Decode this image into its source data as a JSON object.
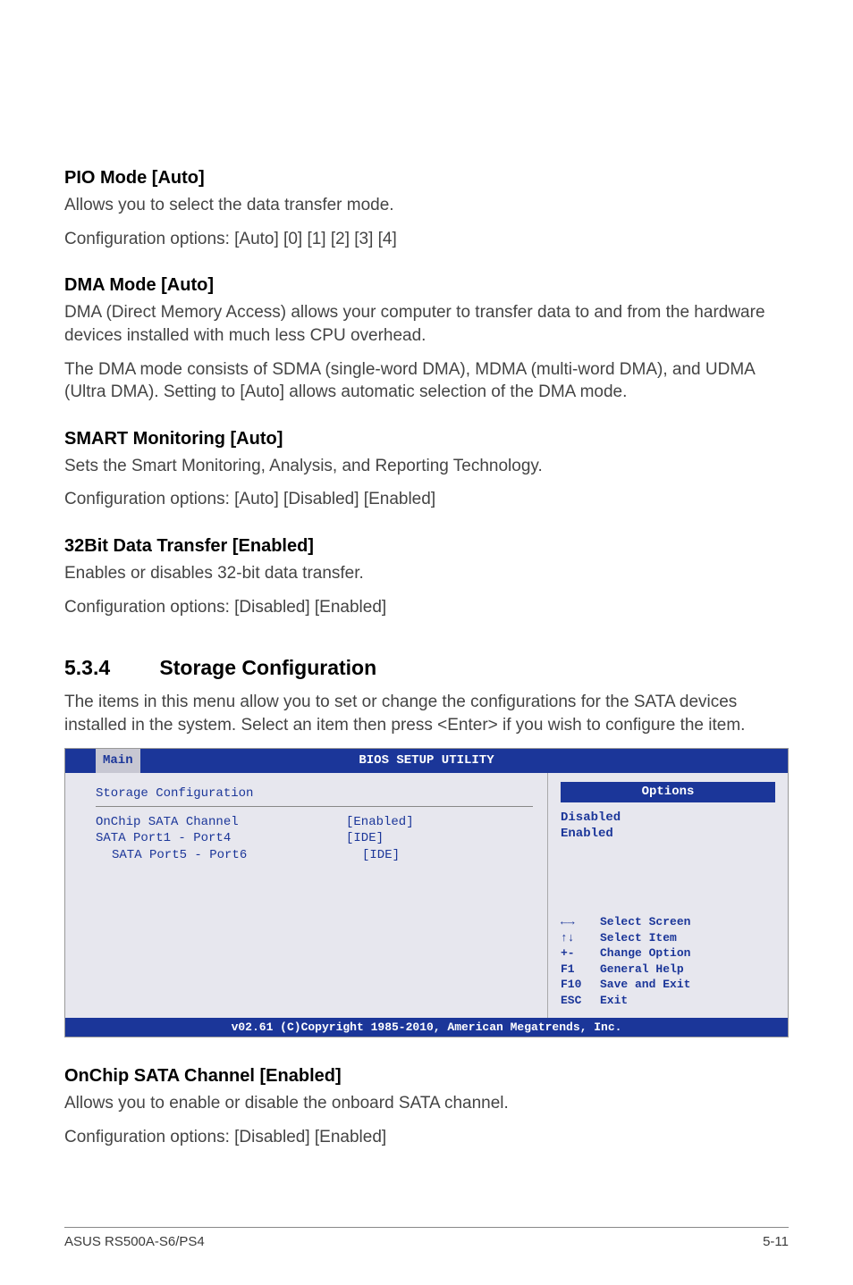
{
  "sections": {
    "pio": {
      "title": "PIO Mode [Auto]",
      "p1": "Allows you to select the data transfer mode.",
      "p2": "Configuration options: [Auto] [0] [1] [2] [3] [4]"
    },
    "dma": {
      "title": "DMA Mode [Auto]",
      "p1": "DMA (Direct Memory Access) allows your computer to transfer data to and from the hardware devices installed with much less CPU overhead.",
      "p2": "The DMA mode consists of SDMA (single-word DMA), MDMA (multi-word DMA), and UDMA (Ultra DMA). Setting to [Auto] allows automatic selection of the DMA mode."
    },
    "smart": {
      "title": "SMART Monitoring [Auto]",
      "p1": "Sets the Smart Monitoring, Analysis, and Reporting Technology.",
      "p2": "Configuration options: [Auto] [Disabled] [Enabled]"
    },
    "bit32": {
      "title": "32Bit Data Transfer [Enabled]",
      "p1": "Enables or disables 32-bit data transfer.",
      "p2": "Configuration options: [Disabled] [Enabled]"
    },
    "storage": {
      "num": "5.3.4",
      "title": "Storage Configuration",
      "intro": "The items in this menu allow you to set or change the configurations for the SATA devices installed in the system. Select an item then press <Enter> if you wish to configure the item."
    },
    "onchip": {
      "title": "OnChip SATA Channel [Enabled]",
      "p1": "Allows you to enable or disable the onboard SATA channel.",
      "p2": "Configuration options: [Disabled] [Enabled]"
    }
  },
  "bios": {
    "header": "BIOS SETUP UTILITY",
    "tab": "Main",
    "section_title": "Storage Configuration",
    "items": [
      {
        "label": "OnChip SATA Channel",
        "value": "[Enabled]"
      },
      {
        "label": "SATA Port1 - Port4",
        "value": "[IDE]"
      },
      {
        "label": "SATA Port5 - Port6",
        "value": "[IDE]"
      }
    ],
    "right_title": "Options",
    "options": [
      "Disabled",
      "Enabled"
    ],
    "help": [
      {
        "key": "←→",
        "text": "Select Screen"
      },
      {
        "key": "↑↓",
        "text": "Select Item"
      },
      {
        "key": "+-",
        "text": "Change Option"
      },
      {
        "key": "F1",
        "text": "General Help"
      },
      {
        "key": "F10",
        "text": "Save and Exit"
      },
      {
        "key": "ESC",
        "text": "Exit"
      }
    ],
    "footer": "v02.61 (C)Copyright 1985-2010, American Megatrends, Inc."
  },
  "page_footer": {
    "left": "ASUS RS500A-S6/PS4",
    "right": "5-11"
  }
}
